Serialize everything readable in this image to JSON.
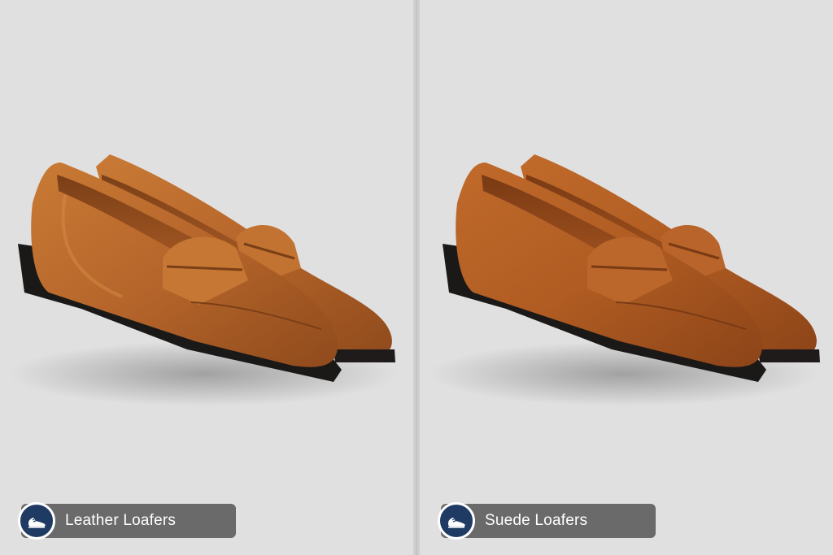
{
  "panels": [
    {
      "label": "Leather Loafers",
      "icon": "shoe-icon",
      "material": "leather",
      "color": "#b96a2a"
    },
    {
      "label": "Suede Loafers",
      "icon": "shoe-icon",
      "material": "suede",
      "color": "#b35e24"
    }
  ],
  "colors": {
    "background": "#e0e0e0",
    "label_background": "#6a6a6a",
    "badge_background": "#1f3b63",
    "label_text": "#ffffff"
  }
}
